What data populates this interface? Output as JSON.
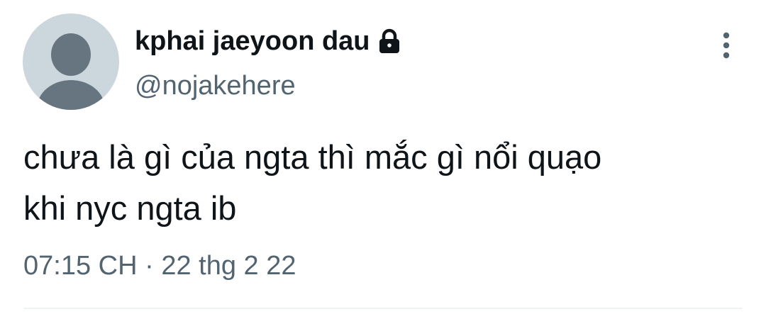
{
  "tweet": {
    "author": {
      "display_name": "kphai jaeyoon dau",
      "handle": "@nojakehere",
      "protected_icon": "lock-icon",
      "avatar": "default-avatar"
    },
    "text": "chưa là gì của ngta thì mắc gì nổi quạo\nkhi nyc ngta ib",
    "time": "07:15 CH",
    "separator": "·",
    "date": "22 thg 2 22",
    "more_icon": "more-vertical-icon"
  },
  "colors": {
    "text_primary": "#0f1419",
    "text_secondary": "#536471",
    "avatar_bg": "#ccd6dd",
    "avatar_fg": "#66757f",
    "divider": "#eff3f4"
  }
}
